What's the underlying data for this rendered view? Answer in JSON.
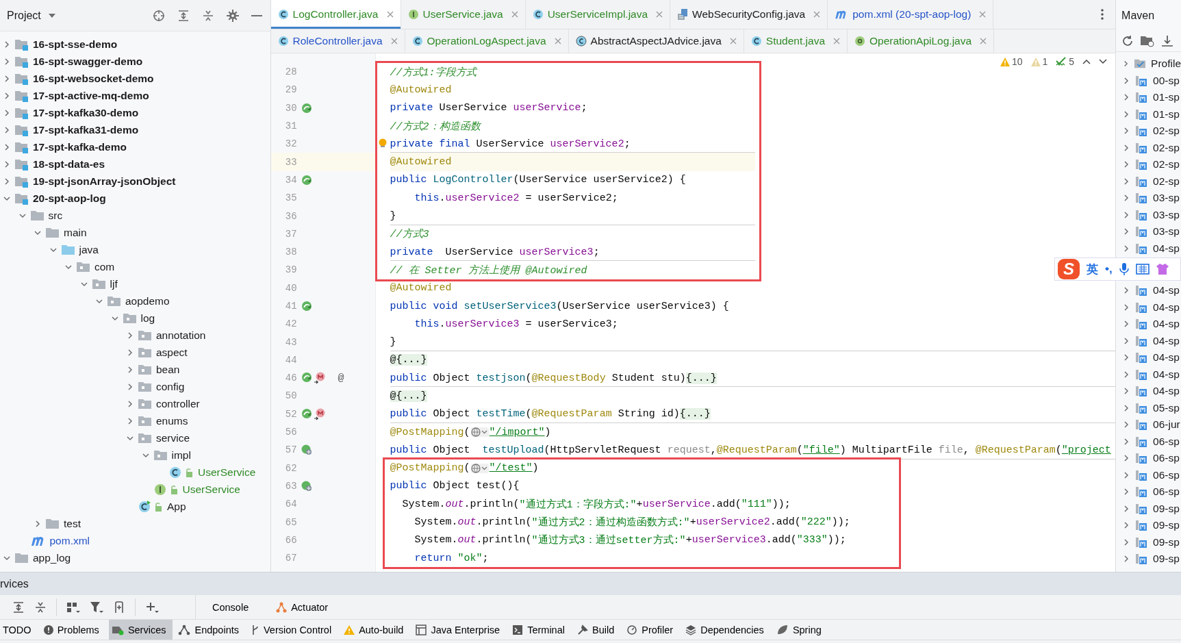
{
  "project_panel": {
    "title": "Project"
  },
  "tree": [
    {
      "label": "16-spt-sse-demo",
      "kind": "module",
      "expanded": false
    },
    {
      "label": "16-spt-swagger-demo",
      "kind": "module",
      "expanded": false
    },
    {
      "label": "16-spt-websocket-demo",
      "kind": "module",
      "expanded": false
    },
    {
      "label": "17-spt-active-mq-demo",
      "kind": "module",
      "expanded": false
    },
    {
      "label": "17-spt-kafka30-demo",
      "kind": "module",
      "expanded": false
    },
    {
      "label": "17-spt-kafka31-demo",
      "kind": "module",
      "expanded": false
    },
    {
      "label": "17-spt-kafka-demo",
      "kind": "module",
      "expanded": false
    },
    {
      "label": "18-spt-data-es",
      "kind": "module",
      "expanded": false
    },
    {
      "label": "19-spt-jsonArray-jsonObject",
      "kind": "module",
      "expanded": false
    },
    {
      "label": "20-spt-aop-log",
      "kind": "module",
      "expanded": true,
      "children": [
        {
          "label": "src",
          "kind": "folder",
          "expanded": true,
          "children": [
            {
              "label": "main",
              "kind": "folder",
              "expanded": true,
              "children": [
                {
                  "label": "java",
                  "kind": "source",
                  "expanded": true,
                  "children": [
                    {
                      "label": "com",
                      "kind": "package",
                      "expanded": true,
                      "children": [
                        {
                          "label": "ljf",
                          "kind": "package",
                          "expanded": true,
                          "children": [
                            {
                              "label": "aopdemo",
                              "kind": "package",
                              "expanded": true,
                              "children": [
                                {
                                  "label": "log",
                                  "kind": "package",
                                  "expanded": true,
                                  "children": [
                                    {
                                      "label": "annotation",
                                      "kind": "package",
                                      "expanded": false
                                    },
                                    {
                                      "label": "aspect",
                                      "kind": "package",
                                      "expanded": false
                                    },
                                    {
                                      "label": "bean",
                                      "kind": "package",
                                      "expanded": false
                                    },
                                    {
                                      "label": "config",
                                      "kind": "package",
                                      "expanded": false
                                    },
                                    {
                                      "label": "controller",
                                      "kind": "package",
                                      "expanded": false
                                    },
                                    {
                                      "label": "enums",
                                      "kind": "package",
                                      "expanded": false
                                    },
                                    {
                                      "label": "service",
                                      "kind": "package",
                                      "expanded": true,
                                      "children": [
                                        {
                                          "label": "impl",
                                          "kind": "package",
                                          "expanded": true,
                                          "children": [
                                            {
                                              "label": "UserService",
                                              "kind": "class",
                                              "color": "#2f8a26"
                                            }
                                          ]
                                        },
                                        {
                                          "label": "UserService",
                                          "kind": "interface",
                                          "color": "#2f8a26"
                                        }
                                      ]
                                    },
                                    {
                                      "label": "App",
                                      "kind": "app"
                                    }
                                  ]
                                }
                              ]
                            }
                          ]
                        }
                      ]
                    }
                  ]
                }
              ]
            },
            {
              "label": "test",
              "kind": "folder",
              "expanded": false
            }
          ]
        },
        {
          "label": "pom.xml",
          "kind": "maven",
          "color": "#2553c8"
        }
      ]
    },
    {
      "label": "app_log",
      "kind": "folder",
      "expanded": true
    }
  ],
  "tab_rows": [
    [
      {
        "label": "LogController.java",
        "kind": "class",
        "color": "#2f8a26",
        "selected": true
      },
      {
        "label": "UserService.java",
        "kind": "interface",
        "color": "#2f8a26",
        "selected": false
      },
      {
        "label": "UserServiceImpl.java",
        "kind": "class",
        "color": "#2f8a26",
        "selected": false
      },
      {
        "label": "WebSecurityConfig.java",
        "kind": "file",
        "selected": false
      },
      {
        "label": "pom.xml (20-spt-aop-log)",
        "kind": "maven",
        "color": "#2553c8",
        "selected": false
      }
    ],
    [
      {
        "label": "RoleController.java",
        "kind": "class",
        "color": "#2553c8",
        "selected": false
      },
      {
        "label": "OperationLogAspect.java",
        "kind": "class",
        "color": "#2f8a26",
        "selected": false
      },
      {
        "label": "AbstractAspectJAdvice.java",
        "kind": "library",
        "selected": false
      },
      {
        "label": "Student.java",
        "kind": "class",
        "color": "#2f8a26",
        "selected": false
      },
      {
        "label": "OperationApiLog.java",
        "kind": "annotation",
        "color": "#2f8a26",
        "selected": false
      }
    ]
  ],
  "inspections": [
    {
      "kind": "warning",
      "count": "10"
    },
    {
      "kind": "weak",
      "count": "1"
    },
    {
      "kind": "typo",
      "count": "5"
    }
  ],
  "code_blocks": [
    {
      "boxed": true,
      "lines": [
        {
          "number": "28",
          "tokens": [
            {
              "kind": "comment",
              "text": "//方式1:字段方式"
            }
          ]
        },
        {
          "number": "29",
          "tokens": [
            {
              "kind": "annotation",
              "text": "@Autowired"
            }
          ]
        },
        {
          "number": "30",
          "gutter": [
            {
              "kind": "bean"
            }
          ],
          "tokens": [
            {
              "kind": "keyword",
              "text": "private "
            },
            {
              "kind": "plain",
              "text": "UserService "
            },
            {
              "kind": "field",
              "text": "userService"
            },
            {
              "kind": "plain",
              "text": ";"
            }
          ]
        },
        {
          "number": "31",
          "tokens": [
            {
              "kind": "comment",
              "text": "//方式2：构造函数"
            }
          ]
        },
        {
          "number": "32",
          "bulb": true,
          "separator": true,
          "tokens": [
            {
              "kind": "keyword",
              "text": "private final "
            },
            {
              "kind": "plain",
              "text": "UserService "
            },
            {
              "kind": "field",
              "text": "userService2"
            },
            {
              "kind": "plain",
              "text": ";"
            }
          ]
        },
        {
          "number": "33",
          "current": true,
          "tokens": [
            {
              "kind": "annotation",
              "text": "@Autowired"
            }
          ]
        },
        {
          "number": "34",
          "gutter": [
            {
              "kind": "bean"
            }
          ],
          "tokens": [
            {
              "kind": "keyword",
              "text": "public "
            },
            {
              "kind": "method",
              "text": "LogController"
            },
            {
              "kind": "plain",
              "text": "(UserService userService2) {"
            }
          ]
        },
        {
          "number": "35",
          "tokens": [
            {
              "kind": "keyword",
              "text": "    this"
            },
            {
              "kind": "plain",
              "text": "."
            },
            {
              "kind": "field",
              "text": "userService2"
            },
            {
              "kind": "plain",
              "text": " = userService2;"
            }
          ]
        },
        {
          "number": "36",
          "separator": true,
          "tokens": [
            {
              "kind": "plain",
              "text": "}"
            }
          ]
        },
        {
          "number": "37",
          "tokens": [
            {
              "kind": "comment",
              "text": "//方式3"
            }
          ]
        },
        {
          "number": "38",
          "separator": true,
          "tokens": [
            {
              "kind": "keyword",
              "text": "private  "
            },
            {
              "kind": "plain",
              "text": "UserService "
            },
            {
              "kind": "field",
              "text": "userService3"
            },
            {
              "kind": "plain",
              "text": ";"
            }
          ]
        },
        {
          "number": "39",
          "tokens": [
            {
              "kind": "comment",
              "text": "// 在 Setter 方法上使用 @Autowired"
            }
          ]
        }
      ]
    },
    {
      "boxed": false,
      "lines": [
        {
          "number": "40",
          "tokens": [
            {
              "kind": "annotation",
              "text": "@Autowired"
            }
          ]
        },
        {
          "number": "41",
          "gutter": [
            {
              "kind": "bean"
            }
          ],
          "tokens": [
            {
              "kind": "keyword",
              "text": "public void "
            },
            {
              "kind": "method",
              "text": "setUserService3"
            },
            {
              "kind": "plain",
              "text": "(UserService userService3) {"
            }
          ]
        },
        {
          "number": "42",
          "tokens": [
            {
              "kind": "keyword",
              "text": "    this"
            },
            {
              "kind": "plain",
              "text": "."
            },
            {
              "kind": "field",
              "text": "userService3"
            },
            {
              "kind": "plain",
              "text": " = userService3;"
            }
          ]
        },
        {
          "number": "43",
          "separator": true,
          "tokens": [
            {
              "kind": "plain",
              "text": "}"
            }
          ]
        },
        {
          "number": "44",
          "tokens": [
            {
              "kind": "folded",
              "text": "@{...}"
            }
          ]
        },
        {
          "number": "46",
          "gutter": [
            {
              "kind": "bean"
            },
            {
              "kind": "mapping"
            }
          ],
          "gutter_mark": "@",
          "separator": true,
          "tokens": [
            {
              "kind": "keyword",
              "text": "public "
            },
            {
              "kind": "plain",
              "text": "Object "
            },
            {
              "kind": "method",
              "text": "testjson"
            },
            {
              "kind": "plain",
              "text": "("
            },
            {
              "kind": "annotation",
              "text": "@RequestBody"
            },
            {
              "kind": "plain",
              "text": " Student stu)"
            },
            {
              "kind": "folded",
              "text": "{...}"
            }
          ]
        },
        {
          "number": "50",
          "tokens": [
            {
              "kind": "folded",
              "text": "@{...}"
            }
          ]
        },
        {
          "number": "52",
          "gutter": [
            {
              "kind": "bean"
            },
            {
              "kind": "mapping"
            }
          ],
          "separator": true,
          "tokens": [
            {
              "kind": "keyword",
              "text": "public "
            },
            {
              "kind": "plain",
              "text": "Object "
            },
            {
              "kind": "method",
              "text": "testTime"
            },
            {
              "kind": "plain",
              "text": "("
            },
            {
              "kind": "annotation",
              "text": "@RequestParam"
            },
            {
              "kind": "plain",
              "text": " String id)"
            },
            {
              "kind": "folded",
              "text": "{...}"
            }
          ]
        },
        {
          "number": "56",
          "tokens": [
            {
              "kind": "annotation",
              "text": "@PostMapping"
            },
            {
              "kind": "plain",
              "text": "("
            },
            {
              "kind": "inlay"
            },
            {
              "kind": "link",
              "text": "\"/import\""
            },
            {
              "kind": "plain",
              "text": ")"
            }
          ]
        },
        {
          "number": "57",
          "gutter": [
            {
              "kind": "web"
            }
          ],
          "separator": true,
          "tokens": [
            {
              "kind": "keyword",
              "text": "public "
            },
            {
              "kind": "plain",
              "text": "Object  "
            },
            {
              "kind": "method",
              "text": "testUpload"
            },
            {
              "kind": "plain",
              "text": "(HttpServletRequest "
            },
            {
              "kind": "unused",
              "text": "request"
            },
            {
              "kind": "plain",
              "text": ","
            },
            {
              "kind": "annotation",
              "text": "@RequestParam"
            },
            {
              "kind": "plain",
              "text": "("
            },
            {
              "kind": "link",
              "text": "\"file\""
            },
            {
              "kind": "plain",
              "text": ") MultipartFile "
            },
            {
              "kind": "unused",
              "text": "file"
            },
            {
              "kind": "plain",
              "text": ", "
            },
            {
              "kind": "annotation",
              "text": "@RequestParam"
            },
            {
              "kind": "plain",
              "text": "("
            },
            {
              "kind": "link",
              "text": "\"project"
            }
          ]
        }
      ]
    },
    {
      "boxed": true,
      "lines": [
        {
          "number": "62",
          "tokens": [
            {
              "kind": "annotation",
              "text": "@PostMapping"
            },
            {
              "kind": "plain",
              "text": "("
            },
            {
              "kind": "inlay"
            },
            {
              "kind": "link",
              "text": "\"/test\""
            },
            {
              "kind": "plain",
              "text": ")"
            }
          ]
        },
        {
          "number": "63",
          "gutter": [
            {
              "kind": "web"
            }
          ],
          "tokens": [
            {
              "kind": "keyword",
              "text": "public "
            },
            {
              "kind": "plain",
              "text": "Object test(){"
            }
          ]
        },
        {
          "number": "64",
          "tokens": [
            {
              "kind": "plain",
              "text": "  System."
            },
            {
              "kind": "static",
              "text": "out"
            },
            {
              "kind": "plain",
              "text": ".println("
            },
            {
              "kind": "string",
              "text": "\"通过方式1：字段方式:\""
            },
            {
              "kind": "plain",
              "text": "+"
            },
            {
              "kind": "field",
              "text": "userService"
            },
            {
              "kind": "plain",
              "text": ".add("
            },
            {
              "kind": "string",
              "text": "\"111\""
            },
            {
              "kind": "plain",
              "text": "));"
            }
          ]
        },
        {
          "number": "65",
          "tokens": [
            {
              "kind": "plain",
              "text": "    System."
            },
            {
              "kind": "static",
              "text": "out"
            },
            {
              "kind": "plain",
              "text": ".println("
            },
            {
              "kind": "string",
              "text": "\"通过方式2：通过构造函数方式:\""
            },
            {
              "kind": "plain",
              "text": "+"
            },
            {
              "kind": "field",
              "text": "userService2"
            },
            {
              "kind": "plain",
              "text": ".add("
            },
            {
              "kind": "string",
              "text": "\"222\""
            },
            {
              "kind": "plain",
              "text": "));"
            }
          ]
        },
        {
          "number": "66",
          "tokens": [
            {
              "kind": "plain",
              "text": "    System."
            },
            {
              "kind": "static",
              "text": "out"
            },
            {
              "kind": "plain",
              "text": ".println("
            },
            {
              "kind": "string",
              "text": "\"通过方式3：通过setter方式:\""
            },
            {
              "kind": "plain",
              "text": "+"
            },
            {
              "kind": "field",
              "text": "userService3"
            },
            {
              "kind": "plain",
              "text": ".add("
            },
            {
              "kind": "string",
              "text": "\"333\""
            },
            {
              "kind": "plain",
              "text": "));"
            }
          ]
        },
        {
          "number": "67",
          "tokens": [
            {
              "kind": "keyword",
              "text": "    return "
            },
            {
              "kind": "string",
              "text": "\"ok\""
            },
            {
              "kind": "plain",
              "text": ";"
            }
          ]
        }
      ]
    }
  ],
  "maven": {
    "title": "Maven",
    "rows": [
      {
        "label": "Profile",
        "kind": "profiles",
        "expanded": false
      },
      {
        "label": "00-sp",
        "kind": "module",
        "expanded": false
      },
      {
        "label": "01-sp",
        "kind": "module",
        "expanded": false
      },
      {
        "label": "01-sp",
        "kind": "module",
        "expanded": false
      },
      {
        "label": "02-sp",
        "kind": "module",
        "expanded": false
      },
      {
        "label": "02-sp",
        "kind": "module",
        "expanded": false
      },
      {
        "label": "02-sp",
        "kind": "module",
        "expanded": false
      },
      {
        "label": "02-sp",
        "kind": "module",
        "expanded": false
      },
      {
        "label": "03-sp",
        "kind": "module",
        "expanded": false
      },
      {
        "label": "03-sp",
        "kind": "module",
        "expanded": false
      },
      {
        "label": "03-sp",
        "kind": "module",
        "expanded": false
      },
      {
        "label": "04-sp",
        "kind": "module",
        "expanded": false
      },
      {
        "label": "04-sp",
        "kind": "module",
        "expanded": false
      },
      {
        "label": "04-sp",
        "kind": "module",
        "expanded": false
      },
      {
        "label": "04-sp",
        "kind": "module",
        "expanded": false
      },
      {
        "label": "04-sp",
        "kind": "module",
        "expanded": false
      },
      {
        "label": "04-sp",
        "kind": "module",
        "expanded": false
      },
      {
        "label": "04-sp",
        "kind": "module",
        "expanded": false
      },
      {
        "label": "04-sp",
        "kind": "module",
        "expanded": false
      },
      {
        "label": "05-sp",
        "kind": "module",
        "expanded": false
      },
      {
        "label": "06-jur",
        "kind": "module",
        "expanded": false
      },
      {
        "label": "06-sp",
        "kind": "module",
        "expanded": false
      },
      {
        "label": "06-sp",
        "kind": "module",
        "expanded": false
      },
      {
        "label": "06-sp",
        "kind": "module",
        "expanded": false
      },
      {
        "label": "06-sp",
        "kind": "module",
        "expanded": false
      },
      {
        "label": "09-sp",
        "kind": "module",
        "expanded": false
      },
      {
        "label": "09-sp",
        "kind": "module",
        "expanded": false
      },
      {
        "label": "09-sp",
        "kind": "module",
        "expanded": false
      },
      {
        "label": "09-sp",
        "kind": "module",
        "expanded": false
      }
    ]
  },
  "ime_toolbar": {
    "logo": "S",
    "mode": "英",
    "punctuation": "•,"
  },
  "services": {
    "title": "rvices",
    "tabs": [
      {
        "label": "Console",
        "kind": "console"
      },
      {
        "label": "Actuator",
        "kind": "actuator"
      }
    ]
  },
  "tool_windows": [
    {
      "label": "TODO",
      "kind": "todo",
      "selected": false
    },
    {
      "label": "Problems",
      "kind": "problems",
      "selected": false
    },
    {
      "label": "Services",
      "kind": "services",
      "selected": true
    },
    {
      "label": "Endpoints",
      "kind": "endpoints",
      "selected": false
    },
    {
      "label": "Version Control",
      "kind": "vcs",
      "selected": false
    },
    {
      "label": "Auto-build",
      "kind": "warning",
      "selected": false
    },
    {
      "label": "Java Enterprise",
      "kind": "enterprise",
      "selected": false
    },
    {
      "label": "Terminal",
      "kind": "terminal",
      "selected": false
    },
    {
      "label": "Build",
      "kind": "build",
      "selected": false
    },
    {
      "label": "Profiler",
      "kind": "profiler",
      "selected": false
    },
    {
      "label": "Dependencies",
      "kind": "dependencies",
      "selected": false
    },
    {
      "label": "Spring",
      "kind": "spring",
      "selected": false
    }
  ]
}
